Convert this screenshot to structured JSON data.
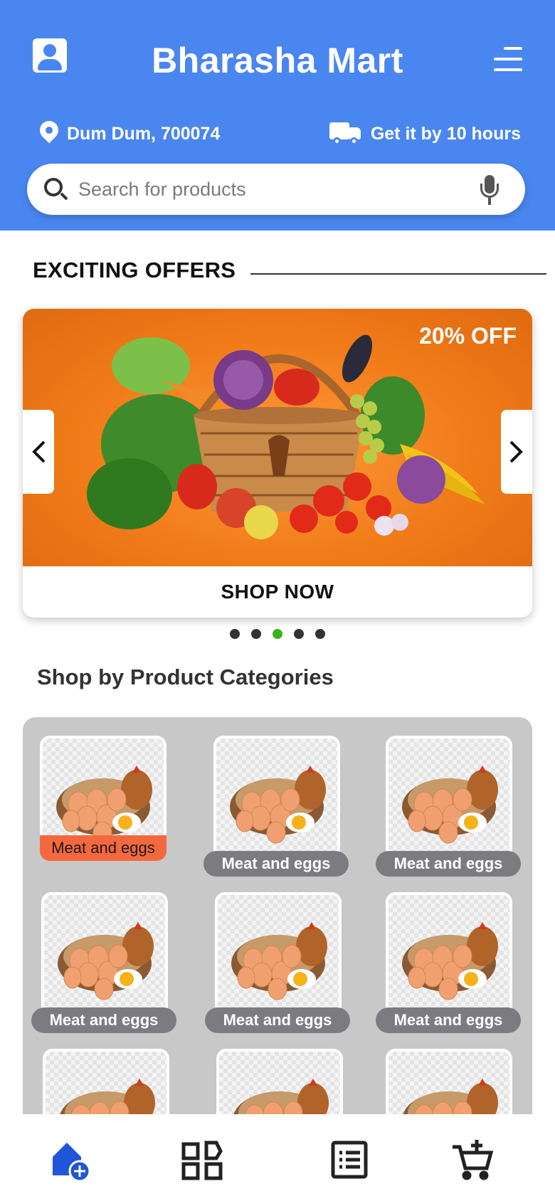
{
  "header": {
    "title": "Bharasha Mart",
    "location": "Dum Dum, 700074",
    "delivery": "Get it by 10 hours",
    "search_placeholder": "Search for products",
    "icons": [
      "profile-icon",
      "menu-icon",
      "location-pin-icon",
      "delivery-truck-icon",
      "search-icon",
      "mic-icon"
    ]
  },
  "offers": {
    "heading": "EXCITING OFFERS",
    "banner_badge": "20% OFF",
    "cta_label": "SHOP NOW",
    "carousel_dots": 5,
    "active_dot": 3
  },
  "categories": {
    "heading": "Shop by Product Categories",
    "items": [
      {
        "label": "Meat and eggs",
        "selected": true
      },
      {
        "label": "Meat and eggs",
        "selected": false
      },
      {
        "label": "Meat and eggs",
        "selected": false
      },
      {
        "label": "Meat and eggs",
        "selected": false
      },
      {
        "label": "Meat and eggs",
        "selected": false
      },
      {
        "label": "Meat and eggs",
        "selected": false
      }
    ]
  },
  "bottom_nav": {
    "items": [
      "home-icon",
      "categories-grid-icon",
      "orders-list-icon",
      "add-to-cart-icon"
    ],
    "active": "home-icon"
  },
  "colors": {
    "header_blue": "#4a86f0",
    "banner_orange": "#f07b18",
    "selected_label": "#f4683e",
    "label_gray": "#7c7c80",
    "active_dot": "#3cb21a"
  }
}
